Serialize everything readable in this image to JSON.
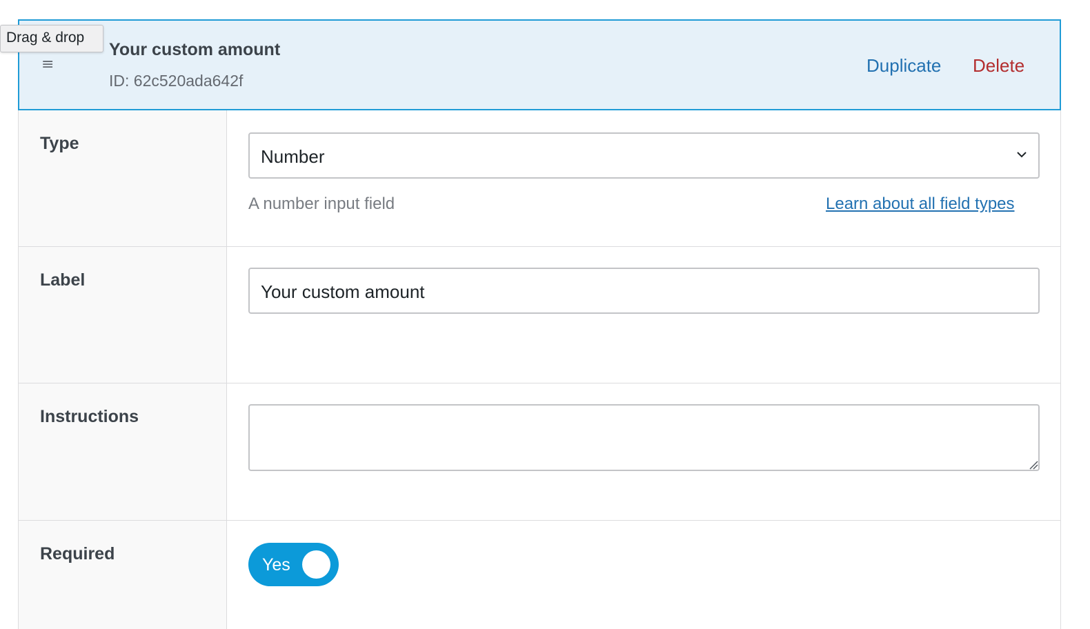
{
  "tooltip": {
    "text": "Drag & drop"
  },
  "field_header": {
    "title": "Your custom amount",
    "id_text": "ID: 62c520ada642f",
    "duplicate_label": "Duplicate",
    "delete_label": "Delete",
    "drag_icon": "hamburger-icon"
  },
  "rows": {
    "type": {
      "label": "Type",
      "selected_value": "Number",
      "help_text": "A number input field",
      "learn_link": "Learn about all field types"
    },
    "label": {
      "label": "Label",
      "value": "Your custom amount"
    },
    "instructions": {
      "label": "Instructions",
      "value": ""
    },
    "required": {
      "label": "Required",
      "toggle_text": "Yes",
      "toggle_on": true
    }
  },
  "colors": {
    "header_bg": "#e6f1f9",
    "header_border": "#1f9bd6",
    "link": "#2271b1",
    "delete": "#b32d2e",
    "toggle": "#0c9ad9"
  }
}
